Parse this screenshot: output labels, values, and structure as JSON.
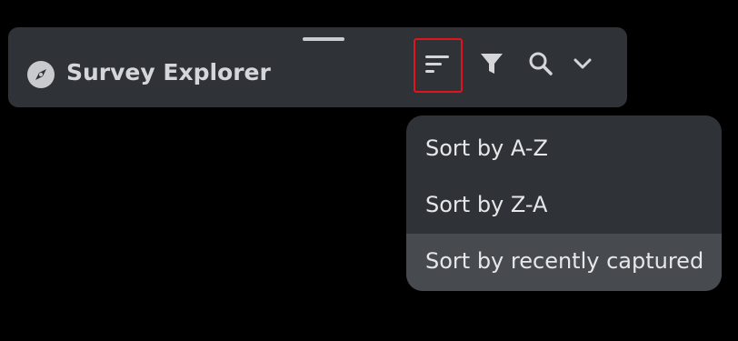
{
  "window": {
    "title": "Survey Explorer",
    "app_icon": "compass-icon"
  },
  "toolbar": {
    "sort_icon": "sort-icon",
    "filter_icon": "filter-icon",
    "search_icon": "search-icon",
    "more_icon": "chevron-down-icon",
    "highlight_color": "#e0141c"
  },
  "sort_menu": {
    "items": [
      {
        "label": "Sort by A-Z",
        "selected": false
      },
      {
        "label": "Sort by Z-A",
        "selected": false
      },
      {
        "label": "Sort by recently captured",
        "selected": true
      }
    ]
  }
}
